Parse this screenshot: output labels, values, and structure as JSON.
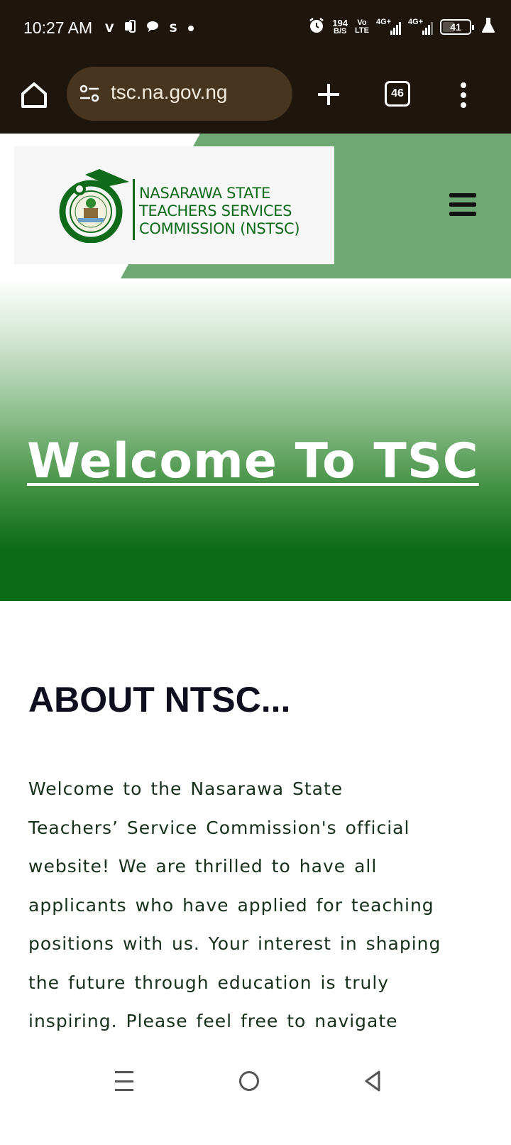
{
  "status_bar": {
    "time": "10:27 AM",
    "net_speed_value": "194",
    "net_speed_unit": "B/S",
    "volte_top": "Vo",
    "volte_bottom": "LTE",
    "sim1_label": "4G+",
    "sim2_label": "4G+",
    "battery": "41",
    "left_icons": [
      "v-icon",
      "notification-app-icon",
      "chat-bubble-icon",
      "s-app-icon",
      "dot-icon"
    ],
    "right_icons": [
      "alarm-icon",
      "signal-icon",
      "battery-icon",
      "flask-icon"
    ]
  },
  "browser": {
    "url": "tsc.na.gov.ng",
    "tab_count": "46",
    "icons": [
      "home-icon",
      "site-settings-icon",
      "new-tab-plus-icon",
      "tabs-icon",
      "more-vert-icon"
    ]
  },
  "site_header": {
    "logo_lines": [
      "NASARAWA STATE",
      "TEACHERS SERVICES",
      "COMMISSION (NSTSC)"
    ]
  },
  "hero": {
    "title": "Welcome To TSC"
  },
  "about": {
    "heading": "ABOUT NTSC...",
    "lines": [
      "Welcome to the Nasarawa State",
      "Teachers’ Service Commission's official",
      "website! We are thrilled to have all",
      "applicants who have applied for teaching",
      "positions with us. Your interest in shaping",
      "the future through education is truly",
      "inspiring. Please feel free to navigate"
    ]
  },
  "colors": {
    "browser_bg": "#1e160d",
    "url_pill": "#473520",
    "header_green": "#6ea872",
    "brand_green": "#0f6b1a",
    "hero_dark_green": "#0a6c14"
  }
}
